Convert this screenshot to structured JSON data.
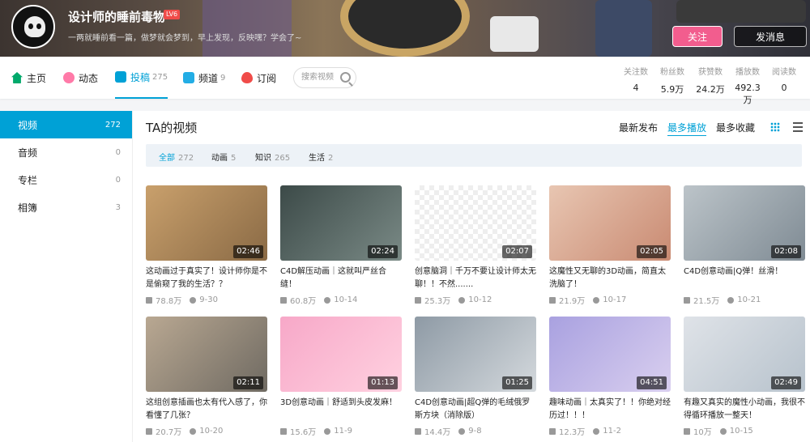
{
  "header": {
    "username": "设计师的睡前毒物",
    "level": "LV6",
    "sign": "一两就睡前看一篇，做梦就会梦到，早上发现，反映嘿？学会了~",
    "follow_label": "关注",
    "message_label": "发消息"
  },
  "nav": {
    "items": [
      {
        "label": "主页",
        "count": ""
      },
      {
        "label": "动态",
        "count": ""
      },
      {
        "label": "投稿",
        "count": "275"
      },
      {
        "label": "频道",
        "count": "9"
      },
      {
        "label": "订阅",
        "count": ""
      }
    ],
    "search_placeholder": "搜索视频"
  },
  "stats": [
    {
      "label": "关注数",
      "value": "4"
    },
    {
      "label": "粉丝数",
      "value": "5.9万"
    },
    {
      "label": "获赞数",
      "value": "24.2万"
    },
    {
      "label": "播放数",
      "value": "492.3万"
    },
    {
      "label": "阅读数",
      "value": "0"
    }
  ],
  "sidebar": {
    "items": [
      {
        "label": "视频",
        "count": "272"
      },
      {
        "label": "音频",
        "count": "0"
      },
      {
        "label": "专栏",
        "count": "0"
      },
      {
        "label": "相簿",
        "count": "3"
      }
    ]
  },
  "main": {
    "title": "TA的视频",
    "sort": [
      "最新发布",
      "最多播放",
      "最多收藏"
    ],
    "filters": [
      {
        "label": "全部",
        "count": "272"
      },
      {
        "label": "动画",
        "count": "5"
      },
      {
        "label": "知识",
        "count": "265"
      },
      {
        "label": "生活",
        "count": "2"
      }
    ]
  },
  "videos": [
    {
      "title": "这动画过于真实了！设计师你是不是偷窥了我的生活？？",
      "duration": "02:46",
      "views": "78.8万",
      "date": "9-30"
    },
    {
      "title": "C4D解压动画｜这就叫严丝合缝！",
      "duration": "02:24",
      "views": "60.8万",
      "date": "10-14"
    },
    {
      "title": "创意脑洞｜千万不要让设计师太无聊！！不然.......",
      "duration": "02:07",
      "views": "25.3万",
      "date": "10-12"
    },
    {
      "title": "这魔性又无聊的3D动画，简直太洗脑了！",
      "duration": "02:05",
      "views": "21.9万",
      "date": "10-17"
    },
    {
      "title": "C4D创意动画|Q弹！丝滑！",
      "duration": "02:08",
      "views": "21.5万",
      "date": "10-21"
    },
    {
      "title": "这组创意插画也太有代入感了，你看懂了几张？",
      "duration": "02:11",
      "views": "20.7万",
      "date": "10-20"
    },
    {
      "title": "3D创意动画｜舒适到头皮发麻！",
      "duration": "01:13",
      "views": "15.6万",
      "date": "11-9"
    },
    {
      "title": "C4D创意动画|超Q弹的毛绒俄罗斯方块（消除版）",
      "duration": "01:25",
      "views": "14.4万",
      "date": "9-8"
    },
    {
      "title": "趣味动画｜太真实了！！你绝对经历过！！！",
      "duration": "04:51",
      "views": "12.3万",
      "date": "11-2"
    },
    {
      "title": "有趣又真实的魔性小动画，我很不得循环播放一整天！",
      "duration": "02:49",
      "views": "10万",
      "date": "10-15"
    }
  ],
  "colors": {
    "accent": "#00a1d6",
    "follow_pink": "#f25d8e",
    "level_red": "#f04c49"
  }
}
